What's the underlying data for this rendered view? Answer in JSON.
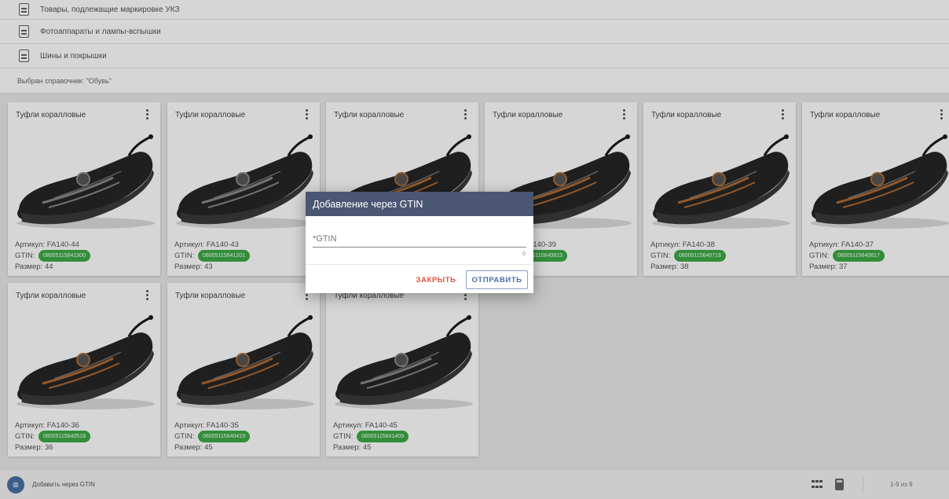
{
  "categories": [
    {
      "label": "Товары, подлежащие маркировке УКЗ"
    },
    {
      "label": "Фотоаппараты и лампы-вспышки"
    },
    {
      "label": "Шины и покрышки"
    }
  ],
  "selected_catalog": "Выбран справочник: \"Обувь\"",
  "labels": {
    "article": "Артикул:",
    "gtin": "GTIN:",
    "size": "Размер:"
  },
  "cards": [
    {
      "title": "Туфли коралловые",
      "article": "FA140-44",
      "gtin": "08005115641300",
      "size": "44",
      "accent": "#8a8a8a"
    },
    {
      "title": "Туфли коралловые",
      "article": "FA140-43",
      "gtin": "08005115641201",
      "size": "43",
      "accent": "#8a8a8a"
    },
    {
      "title": "Туфли коралловые",
      "article": "",
      "gtin": "",
      "size": "",
      "accent": "#b06a34"
    },
    {
      "title": "Туфли коралловые",
      "article": "FA140-39",
      "gtin": "08005115640815",
      "size": "",
      "accent": "#b06a34"
    },
    {
      "title": "Туфли коралловые",
      "article": "FA140-38",
      "gtin": "08005115640716",
      "size": "38",
      "accent": "#b06a34"
    },
    {
      "title": "Туфли коралловые",
      "article": "FA140-37",
      "gtin": "08005115640617",
      "size": "37",
      "accent": "#b06a34"
    },
    {
      "title": "Туфли коралловые",
      "article": "FA140-36",
      "gtin": "08005115640518",
      "size": "36",
      "accent": "#b06a34"
    },
    {
      "title": "Туфли коралловые",
      "article": "FA140-35",
      "gtin": "08005115640419",
      "size": "45",
      "accent": "#b06a34"
    },
    {
      "title": "Туфли коралловые",
      "article": "FA140-45",
      "gtin": "08005115641409",
      "size": "45",
      "accent": "#8a8a8a"
    }
  ],
  "dialog": {
    "title": "Добавление через GTIN",
    "field_placeholder": "*GTIN",
    "field_value": "",
    "counter": "0",
    "close_label": "ЗАКРЫТЬ",
    "send_label": "ОТПРАВИТЬ"
  },
  "footer": {
    "add_label": "Добавить через GTIN",
    "pager": "1-9 из 9",
    "icons": [
      "barcode-icon",
      "grid-view-icon",
      "calculator-icon"
    ]
  },
  "colors": {
    "dialog_header": "#4b5672",
    "gtin_badge": "#3daa46",
    "close": "#e0523a",
    "send": "#4a6fa5"
  }
}
